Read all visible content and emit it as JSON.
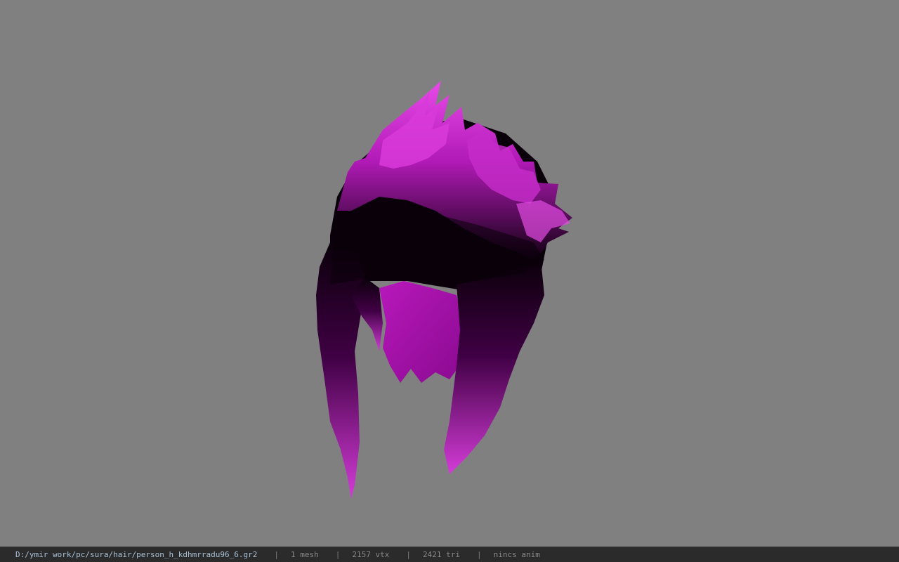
{
  "viewport": {
    "background": "#808080",
    "model": {
      "name": "hair-mesh",
      "colors": {
        "highlight": "#e040e8",
        "mid": "#a010a8",
        "shadow": "#0a000a"
      }
    }
  },
  "statusbar": {
    "path": "D:/ymir work/pc/sura/hair/person_h_kdhmrradu96_6.gr2",
    "separator": "|",
    "mesh": "1 mesh",
    "vtx": "2157 vtx",
    "tri": "2421 tri",
    "anim": "nincs anim"
  }
}
